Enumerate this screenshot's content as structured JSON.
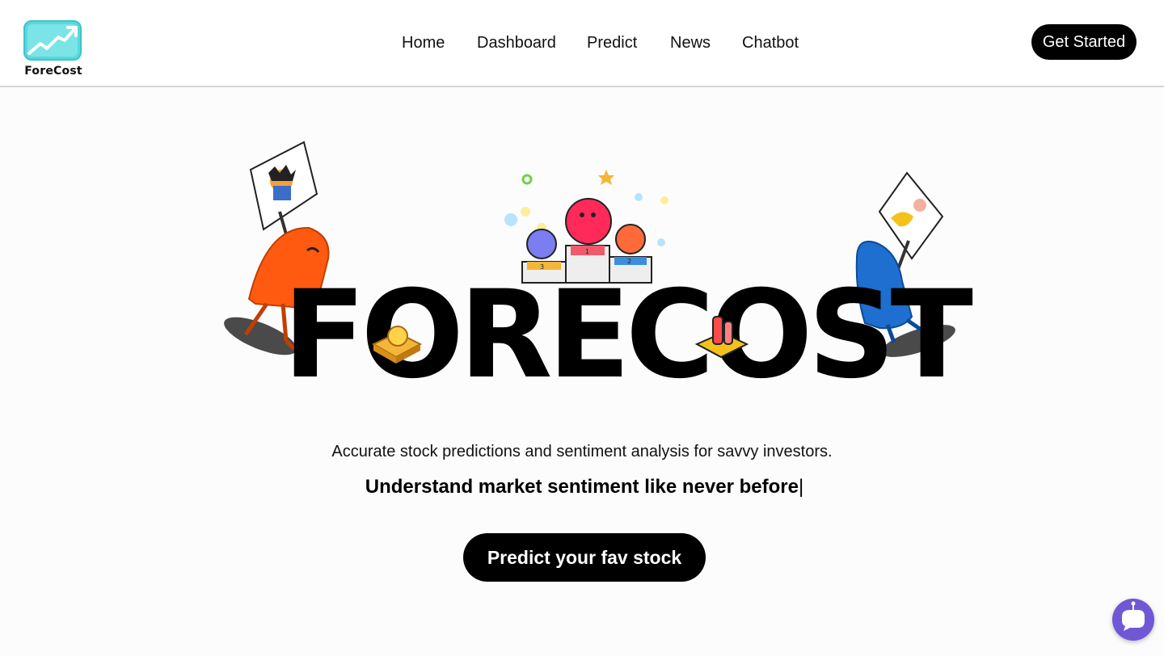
{
  "brand": {
    "name": "ForeCost",
    "logo_icon": "trend-chart-icon",
    "logo_color": "#5ad8dc"
  },
  "nav": {
    "items": [
      {
        "label": "Home"
      },
      {
        "label": "Dashboard"
      },
      {
        "label": "Predict"
      },
      {
        "label": "News"
      },
      {
        "label": "Chatbot"
      }
    ],
    "cta_label": "Get Started"
  },
  "hero": {
    "title": "FORECOST",
    "tagline": "Accurate stock predictions and sentiment analysis for savvy investors.",
    "subline": "Understand market sentiment like never before",
    "cursor": "|",
    "cta_label": "Predict your fav stock",
    "podium_places": [
      "3",
      "1",
      "2"
    ]
  },
  "chat": {
    "icon": "chat-bubble-icon",
    "color": "#6f57d6"
  },
  "colors": {
    "accent": "#000000",
    "orange_character": "#ff5a10",
    "blue_character": "#1e6fd0",
    "background": "#fcfcfc"
  }
}
